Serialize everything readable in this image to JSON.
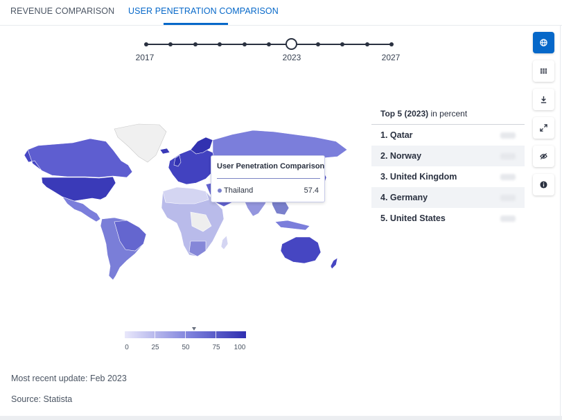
{
  "tabs": [
    {
      "label": "REVENUE COMPARISON",
      "active": false
    },
    {
      "label": "USER PENETRATION COMPARISON",
      "active": true
    }
  ],
  "timeline": {
    "labels": [
      "2017",
      "2023",
      "2027"
    ],
    "selected": "2023"
  },
  "toolbar": [
    "globe-icon",
    "grid-icon",
    "download-icon",
    "expand-icon",
    "eye-off-icon",
    "info-icon"
  ],
  "tooltip": {
    "title": "User Penetration Comparison",
    "country": "Thailand",
    "value": "57.4"
  },
  "legend": {
    "labels": [
      "0",
      "25",
      "50",
      "75",
      "100"
    ],
    "marker_value": 57.4
  },
  "top5": {
    "heading_bold": "Top 5 (2023)",
    "heading_unit": " in percent",
    "items": [
      {
        "rank_label": "1. Qatar"
      },
      {
        "rank_label": "2. Norway"
      },
      {
        "rank_label": "3. United Kingdom"
      },
      {
        "rank_label": "4. Germany"
      },
      {
        "rank_label": "5. United States"
      }
    ]
  },
  "footer": {
    "update": "Most recent update: Feb 2023",
    "source": "Source: Statista"
  },
  "colors": {
    "accent": "#0668c9",
    "map_low": "#e9e8fb",
    "map_mid": "#7b7edb",
    "map_high": "#2f2fb0",
    "map_nodata": "#f0f0f0"
  }
}
